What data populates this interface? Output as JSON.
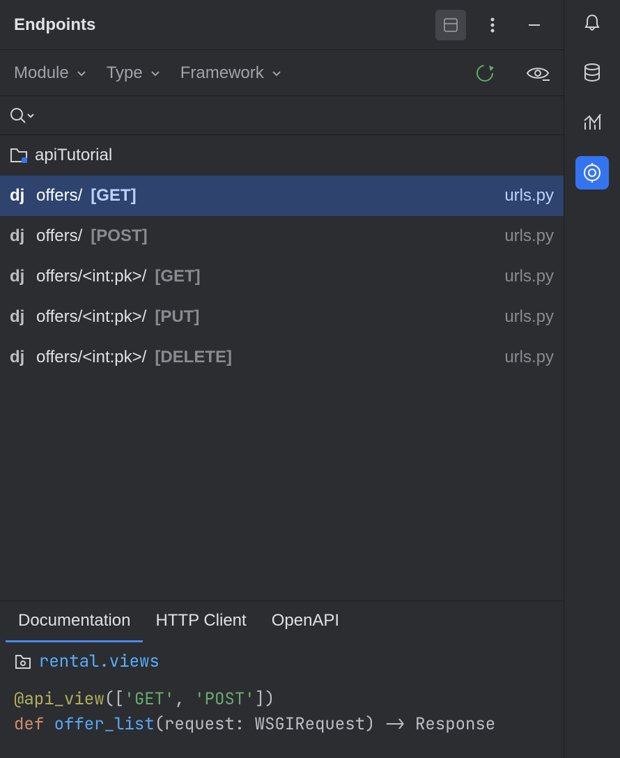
{
  "header": {
    "title": "Endpoints"
  },
  "filters": {
    "module": "Module",
    "type": "Type",
    "framework": "Framework"
  },
  "project": {
    "name": "apiTutorial"
  },
  "endpoints": [
    {
      "tag": "dj",
      "path": "offers/",
      "method": "[GET]",
      "file": "urls.py",
      "selected": true
    },
    {
      "tag": "dj",
      "path": "offers/",
      "method": "[POST]",
      "file": "urls.py",
      "selected": false
    },
    {
      "tag": "dj",
      "path": "offers/<int:pk>/",
      "method": "[GET]",
      "file": "urls.py",
      "selected": false
    },
    {
      "tag": "dj",
      "path": "offers/<int:pk>/",
      "method": "[PUT]",
      "file": "urls.py",
      "selected": false
    },
    {
      "tag": "dj",
      "path": "offers/<int:pk>/",
      "method": "[DELETE]",
      "file": "urls.py",
      "selected": false
    }
  ],
  "bottom_tabs": [
    {
      "label": "Documentation",
      "active": true
    },
    {
      "label": "HTTP Client",
      "active": false
    },
    {
      "label": "OpenAPI",
      "active": false
    }
  ],
  "doc": {
    "module": "rental.views",
    "decorator_name": "@api_view",
    "decorator_open": "([",
    "decorator_str1": "'GET'",
    "decorator_sep": ", ",
    "decorator_str2": "'POST'",
    "decorator_close": "])",
    "def_kw": "def ",
    "fn_name": "offer_list",
    "sig": "(request: WSGIRequest) -> Response"
  }
}
